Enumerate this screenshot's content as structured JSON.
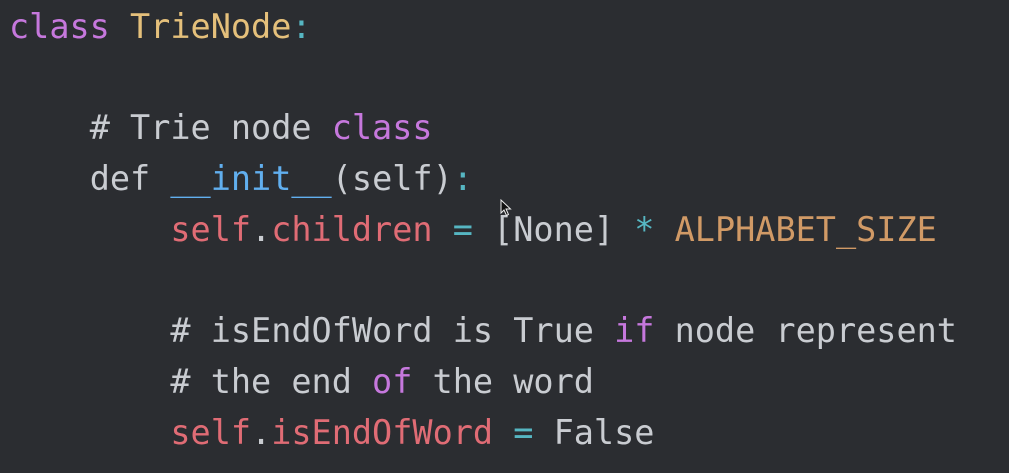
{
  "code": {
    "line1": {
      "kw": "class",
      "name": "TrieNode",
      "colon": ":"
    },
    "line3": {
      "comment_prefix": "# Trie node ",
      "comment_kw": "class"
    },
    "line4": {
      "kw": "def",
      "fn": "__init__",
      "args": "(self)",
      "colon": ":"
    },
    "line5": {
      "self": "self",
      "dot": ".",
      "attr": "children",
      "eq": "=",
      "list": "[None]",
      "star": "*",
      "const": "ALPHABET_SIZE"
    },
    "line7": {
      "prefix": "# isEndOfWord is True ",
      "kw": "if",
      "suffix": " node represent"
    },
    "line8": {
      "prefix": "# the end ",
      "kw": "of",
      "suffix": " the word"
    },
    "line9": {
      "self": "self",
      "dot": ".",
      "attr": "isEndOfWord",
      "eq": "=",
      "value": "False"
    }
  },
  "colors": {
    "background": "#2b2d31",
    "keyword": "#c678dd",
    "class_name": "#e5c07b",
    "function": "#61afef",
    "self": "#e06c75",
    "operator": "#56b6c2",
    "constant": "#d19a66",
    "plain": "#c9ccd1"
  },
  "icons": {
    "cursor": "mouse-pointer-icon"
  }
}
